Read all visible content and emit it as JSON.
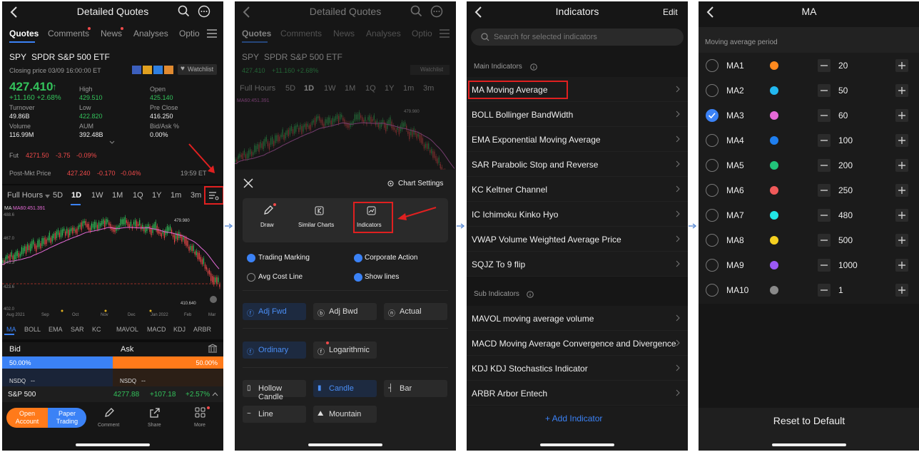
{
  "colors": {
    "accent": "#3b82f6",
    "up": "#33c25b",
    "down": "#f04a4a",
    "highlight": "#e02020",
    "orange": "#ff7a1a"
  },
  "screen1": {
    "title": "Detailed Quotes",
    "tabs": [
      "Quotes",
      "Comments",
      "News",
      "Analyses",
      "Optio"
    ],
    "symbol": "SPY",
    "name": "SPDR S&P 500 ETF",
    "closing": "Closing price 03/09 16:00:00 ET",
    "watchlist": "Watchlist",
    "price": "427.410",
    "change": "+11.160 +2.68%",
    "stats": [
      {
        "label": "High",
        "value": "429.510",
        "cls": "green"
      },
      {
        "label": "Open",
        "value": "425.140",
        "cls": "green"
      },
      {
        "label": "Turnover",
        "value": "49.86B",
        "cls": "w"
      },
      {
        "label": "Low",
        "value": "422.820",
        "cls": "green"
      },
      {
        "label": "Pre Close",
        "value": "416.250",
        "cls": "w"
      },
      {
        "label": "Volume",
        "value": "116.99M",
        "cls": "w"
      },
      {
        "label": "AUM",
        "value": "392.48B",
        "cls": "w"
      },
      {
        "label": "Bid/Ask %",
        "value": "0.00%",
        "cls": "w"
      }
    ],
    "fut_label": "Fut",
    "fut_price": "4271.50",
    "fut_change": "-3.75",
    "fut_pct": "-0.09%",
    "post_label": "Post-Mkt Price",
    "post_price": "427.240",
    "post_change": "-0.170",
    "post_pct": "-0.04%",
    "post_time": "19:59 ET",
    "timeframes": [
      "Full Hours",
      "5D",
      "1D",
      "1W",
      "1M",
      "1Q",
      "1Y",
      "1m",
      "3m"
    ],
    "ma_label": "MA",
    "ma_value": "MA60:451.391",
    "y_ticks": [
      "488.6",
      "467.0",
      "445.3",
      "423.6",
      "402.0"
    ],
    "high_mark": "479.980",
    "low_mark": "410.640",
    "x_ticks": [
      "Aug 2021",
      "Sep",
      "Oct",
      "Nov",
      "Dec",
      "Jan 2022",
      "Feb",
      "Mar"
    ],
    "indicators": [
      "MA",
      "BOLL",
      "EMA",
      "SAR",
      "KC",
      "MAVOL",
      "MACD",
      "KDJ",
      "ARBR"
    ],
    "bid": "Bid",
    "ask": "Ask",
    "bid_pct": "50.00%",
    "ask_pct": "50.00%",
    "nsdq": "NSDQ",
    "dash": "--",
    "index_name": "S&P 500",
    "index_price": "4277.88",
    "index_change": "+107.18",
    "index_pct": "+2.57%",
    "open_account": "Open Account",
    "paper_trading": "Paper Trading",
    "nav": [
      "Comment",
      "Share",
      "More"
    ]
  },
  "screen2": {
    "title": "Detailed Quotes",
    "chart_settings": "Chart Settings",
    "tools": [
      "Draw",
      "Similar Charts",
      "Indicators"
    ],
    "checks": [
      {
        "label": "Trading Marking",
        "on": true
      },
      {
        "label": "Corporate Action",
        "on": true
      },
      {
        "label": "Avg Cost Line",
        "on": false
      },
      {
        "label": "Show lines",
        "on": true
      }
    ],
    "adjust": [
      "Adj Fwd",
      "Adj Bwd",
      "Actual"
    ],
    "scale": [
      "Ordinary",
      "Logarithmic"
    ],
    "styles": [
      "Hollow Candle",
      "Candle",
      "Bar",
      "Line",
      "Mountain"
    ],
    "high_mark": "479.980"
  },
  "screen3": {
    "title": "Indicators",
    "edit": "Edit",
    "search_placeholder": "Search for selected indicators",
    "main_header": "Main Indicators",
    "main": [
      "MA Moving Average",
      "BOLL Bollinger BandWidth",
      "EMA Exponential Moving Average",
      "SAR Parabolic Stop and Reverse",
      "KC Keltner Channel",
      "IC Ichimoku Kinko Hyo",
      "VWAP Volume Weighted Average Price",
      "SQJZ To 9 flip"
    ],
    "sub_header": "Sub Indicators",
    "sub": [
      "MAVOL moving average volume",
      "MACD Moving Average Convergence and Divergence",
      "KDJ KDJ Stochastics Indicator",
      "ARBR Arbor Entech"
    ],
    "add": "+ Add Indicator"
  },
  "screen4": {
    "title": "MA",
    "period_label": "Moving average period",
    "rows": [
      {
        "name": "MA1",
        "color": "#ff8a1f",
        "value": "20",
        "on": false
      },
      {
        "name": "MA2",
        "color": "#22b8f0",
        "value": "50",
        "on": false
      },
      {
        "name": "MA3",
        "color": "#e66ad8",
        "value": "60",
        "on": true
      },
      {
        "name": "MA4",
        "color": "#1f7ff0",
        "value": "100",
        "on": false
      },
      {
        "name": "MA5",
        "color": "#22c47a",
        "value": "200",
        "on": false
      },
      {
        "name": "MA6",
        "color": "#f05a5a",
        "value": "250",
        "on": false
      },
      {
        "name": "MA7",
        "color": "#22e6e6",
        "value": "480",
        "on": false
      },
      {
        "name": "MA8",
        "color": "#f5d020",
        "value": "500",
        "on": false
      },
      {
        "name": "MA9",
        "color": "#9b59f5",
        "value": "1000",
        "on": false
      },
      {
        "name": "MA10",
        "color": "#8a8a8a",
        "value": "1",
        "on": false
      }
    ],
    "reset": "Reset to Default"
  }
}
